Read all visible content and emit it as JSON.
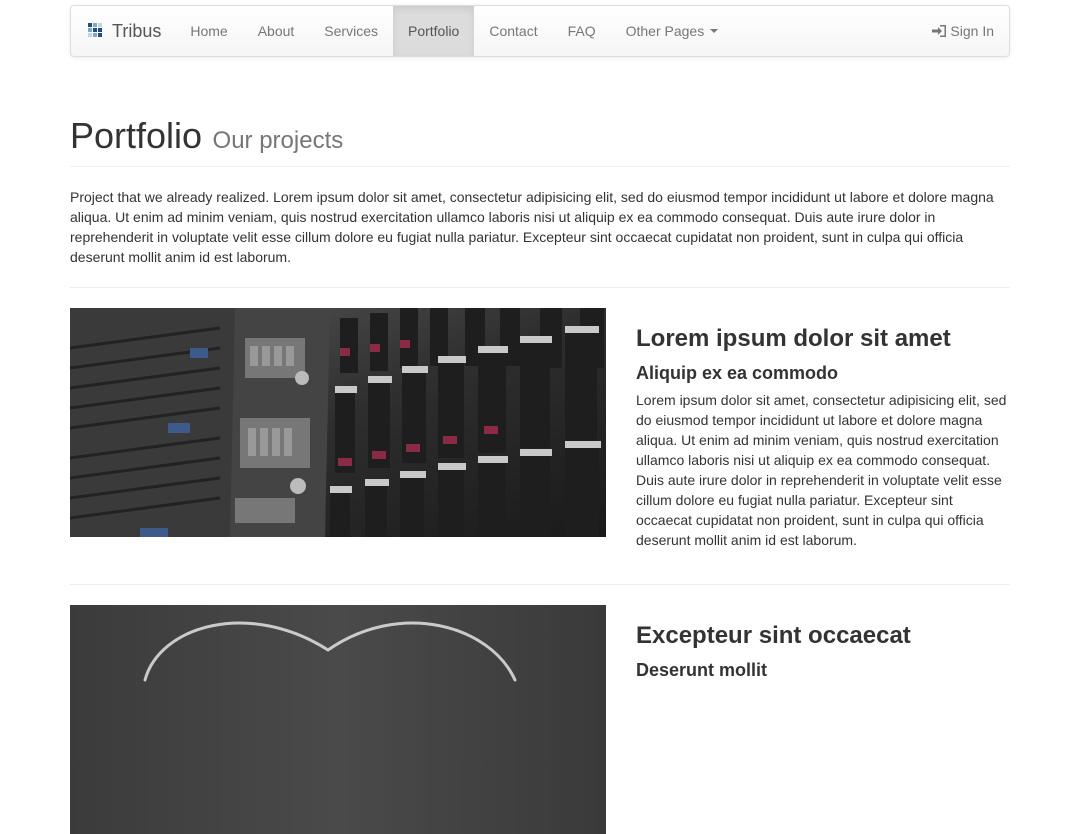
{
  "navbar": {
    "brand": "Tribus",
    "items": [
      {
        "label": "Home",
        "active": false
      },
      {
        "label": "About",
        "active": false
      },
      {
        "label": "Services",
        "active": false
      },
      {
        "label": "Portfolio",
        "active": true
      },
      {
        "label": "Contact",
        "active": false
      },
      {
        "label": "FAQ",
        "active": false
      }
    ],
    "dropdown_label": "Other Pages",
    "signin_label": "Sign In"
  },
  "header": {
    "title": "Portfolio",
    "subtitle": "Our projects"
  },
  "intro": "Project that we already realized. Lorem ipsum dolor sit amet, consectetur adipisicing elit, sed do eiusmod tempor incididunt ut labore et dolore magna aliqua. Ut enim ad minim veniam, quis nostrud exercitation ullamco laboris nisi ut aliquip ex ea commodo consequat. Duis aute irure dolor in reprehenderit in voluptate velit esse cillum dolore eu fugiat nulla pariatur. Excepteur sint occaecat cupidatat non proident, sunt in culpa qui officia deserunt mollit anim id est laborum.",
  "projects": [
    {
      "title": "Lorem ipsum dolor sit amet",
      "subtitle": "Aliquip ex ea commodo",
      "description": "Lorem ipsum dolor sit amet, consectetur adipisicing elit, sed do eiusmod tempor incididunt ut labore et dolore magna aliqua. Ut enim ad minim veniam, quis nostrud exercitation ullamco laboris nisi ut aliquip ex ea commodo consequat. Duis aute irure dolor in reprehenderit in voluptate velit esse cillum dolore eu fugiat nulla pariatur. Excepteur sint occaecat cupidatat non proident, sunt in culpa qui officia deserunt mollit anim id est laborum.",
      "image": "server-rack-photo"
    },
    {
      "title": "Excepteur sint occaecat",
      "subtitle": "Deserunt mollit",
      "description": "",
      "image": "chalkboard-heart-photo"
    }
  ],
  "icons": {
    "brand_logo": "grid-logo-icon",
    "dropdown": "caret-down-icon",
    "signin": "log-in-icon"
  },
  "colors": {
    "navbar_active_bg": "#dcdcdc",
    "nav_text": "#777777",
    "text": "#333333",
    "muted": "#777777",
    "brand_logo": "#1f4e79"
  }
}
